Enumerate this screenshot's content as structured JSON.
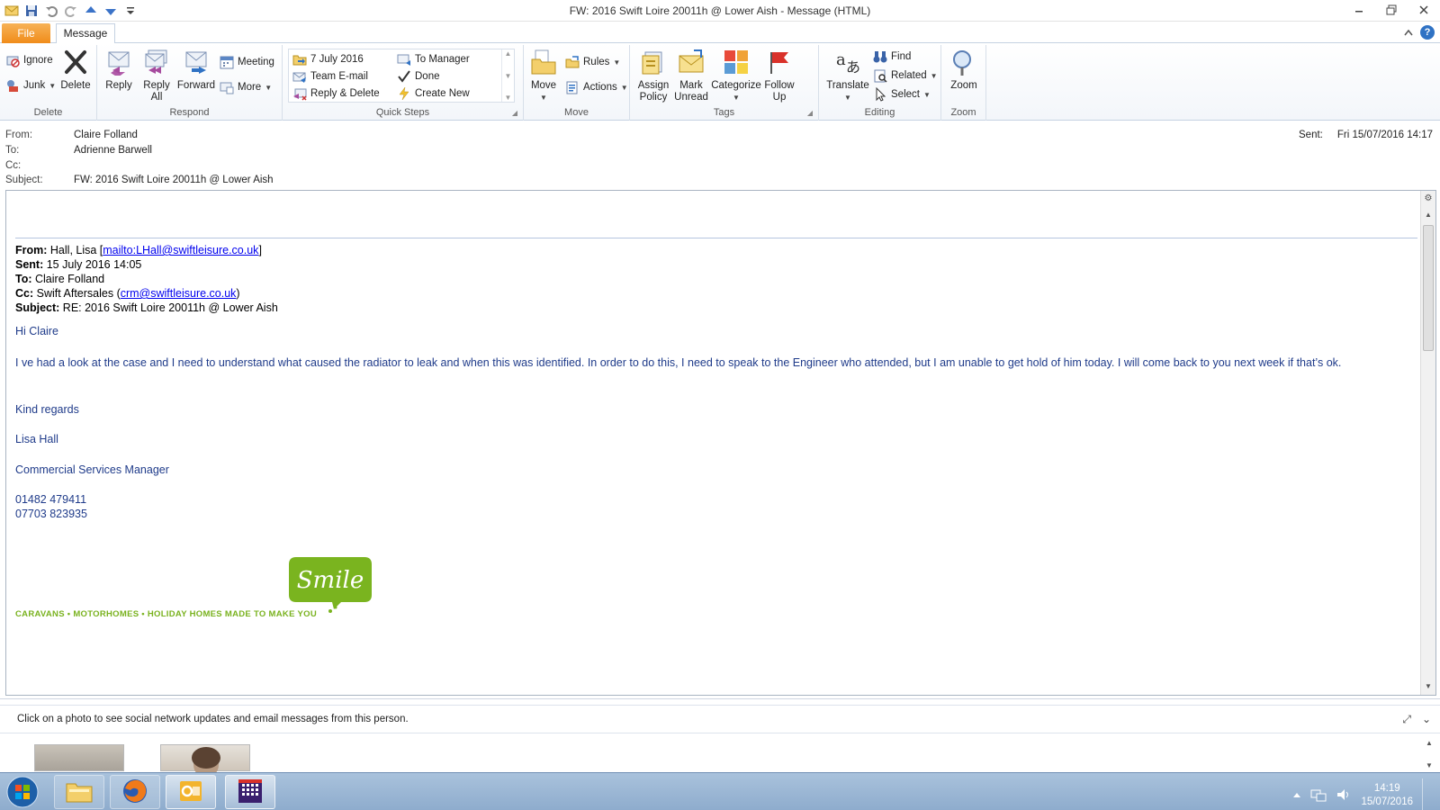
{
  "window": {
    "title": "FW: 2016 Swift Loire 20011h @ Lower Aish  -  Message (HTML)"
  },
  "tabs": {
    "file": "File",
    "message": "Message"
  },
  "ribbon": {
    "delete_group": {
      "label": "Delete",
      "ignore": "Ignore",
      "junk": "Junk",
      "delete": "Delete"
    },
    "respond_group": {
      "label": "Respond",
      "reply": "Reply",
      "reply_all_1": "Reply",
      "reply_all_2": "All",
      "forward": "Forward",
      "meeting": "Meeting",
      "more": "More"
    },
    "quicksteps_group": {
      "label": "Quick Steps",
      "items": [
        "7 July 2016",
        "Team E-mail",
        "Reply & Delete",
        "To Manager",
        "Done",
        "Create New"
      ]
    },
    "move_group": {
      "label": "Move",
      "move": "Move",
      "rules": "Rules",
      "actions": "Actions"
    },
    "tags_group": {
      "label": "Tags",
      "assign_1": "Assign",
      "assign_2": "Policy",
      "mark_1": "Mark",
      "mark_2": "Unread",
      "categorize": "Categorize",
      "follow_1": "Follow",
      "follow_2": "Up"
    },
    "editing_group": {
      "label": "Editing",
      "translate": "Translate",
      "find": "Find",
      "related": "Related",
      "select": "Select"
    },
    "zoom_group": {
      "label": "Zoom",
      "zoom": "Zoom"
    }
  },
  "header": {
    "from_label": "From:",
    "from": "Claire Folland",
    "to_label": "To:",
    "to": "Adrienne Barwell",
    "cc_label": "Cc:",
    "cc": "",
    "subject_label": "Subject:",
    "subject": "FW: 2016 Swift Loire 20011h @ Lower Aish",
    "sent_label": "Sent:",
    "sent": "Fri 15/07/2016 14:17"
  },
  "forwarded": {
    "from_label": "From:",
    "from_name": "Hall, Lisa [",
    "from_link": "mailto:LHall@swiftleisure.co.uk",
    "from_close": "]",
    "sent_label": "Sent:",
    "sent": "15 July 2016 14:05",
    "to_label": "To:",
    "to": "Claire Folland",
    "cc_label": "Cc:",
    "cc_name": "Swift Aftersales (",
    "cc_link": "crm@swiftleisure.co.uk",
    "cc_close": ")",
    "subject_label": "Subject:",
    "subject": "RE: 2016 Swift Loire 20011h @ Lower Aish"
  },
  "body": {
    "greeting": "Hi Claire",
    "paragraph": "I ve had a look at the case and I need to understand what caused the radiator to leak and when this was identified. In order to do this, I need to speak to the Engineer who attended, but I am unable to get hold of him today. I will come back to you next week if that’s ok.",
    "regards": "Kind regards",
    "name": "Lisa Hall",
    "role": "Commercial Services Manager",
    "phone1": "01482 479411",
    "phone2": "07703 823935",
    "logo_word": "Smile",
    "logo_tagline": "CARAVANS • MOTORHOMES • HOLIDAY HOMES MADE TO MAKE YOU"
  },
  "people_pane": {
    "hint": "Click on a photo to see social network updates and email messages from this person."
  },
  "taskbar": {
    "time": "14:19",
    "date": "15/07/2016"
  },
  "colors": {
    "file_tab": "#f08c1a",
    "body_text": "#1f3b8a",
    "brand_green": "#79b21e",
    "taskbar": "#8eaccd"
  }
}
